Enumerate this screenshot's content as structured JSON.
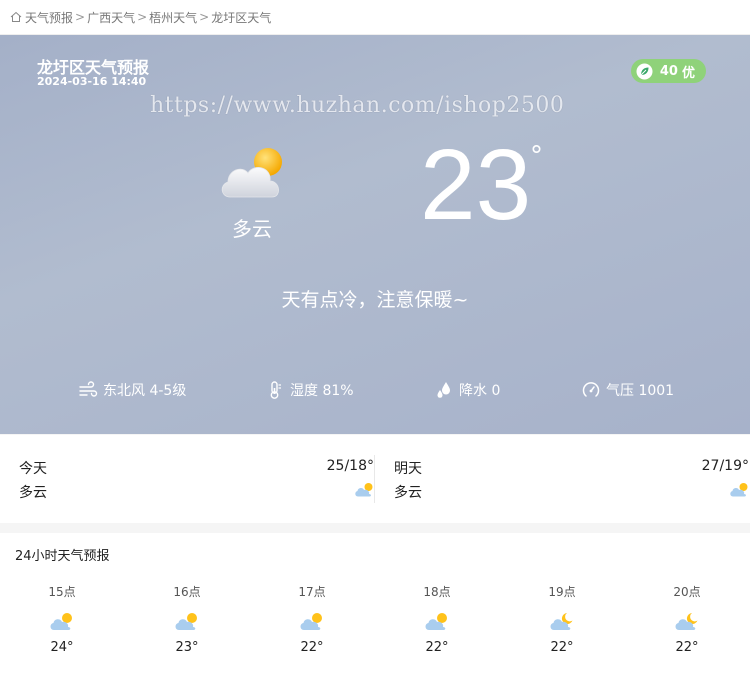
{
  "breadcrumb": {
    "items": [
      "天气预报",
      "广西天气",
      "梧州天气",
      "龙圩区天气"
    ],
    "separator": ">"
  },
  "current": {
    "city_title": "龙圩区天气预报",
    "updated": "2024-03-16 14:40",
    "aqi_value": "40",
    "aqi_level": "优",
    "watermark": "https://www.huzhan.com/ishop2500",
    "condition": "多云",
    "temperature": "23",
    "degree_symbol": "°",
    "tip": "天有点冷，注意保暖~",
    "wind": "东北风 4-5级",
    "humidity": "湿度 81%",
    "precipitation": "降水 0",
    "pressure": "气压 1001"
  },
  "days": [
    {
      "label": "今天",
      "range": "25/18°",
      "condition": "多云",
      "icon": "partly-cloudy-day-icon"
    },
    {
      "label": "明天",
      "range": "27/19°",
      "condition": "多云",
      "icon": "partly-cloudy-day-icon"
    }
  ],
  "hourly": {
    "title": "24小时天气预报",
    "items": [
      {
        "hour": "15点",
        "temp": "24°",
        "icon": "partly-cloudy-day-icon"
      },
      {
        "hour": "16点",
        "temp": "23°",
        "icon": "partly-cloudy-day-icon"
      },
      {
        "hour": "17点",
        "temp": "22°",
        "icon": "partly-cloudy-day-icon"
      },
      {
        "hour": "18点",
        "temp": "22°",
        "icon": "partly-cloudy-day-icon"
      },
      {
        "hour": "19点",
        "temp": "22°",
        "icon": "partly-cloudy-night-icon"
      },
      {
        "hour": "20点",
        "temp": "22°",
        "icon": "partly-cloudy-night-icon"
      }
    ]
  },
  "colors": {
    "hero_bg": "#a8b3ca",
    "aqi_badge": "#8fd27a",
    "cloud": "#a9cdee",
    "sun": "#ffc21a"
  }
}
